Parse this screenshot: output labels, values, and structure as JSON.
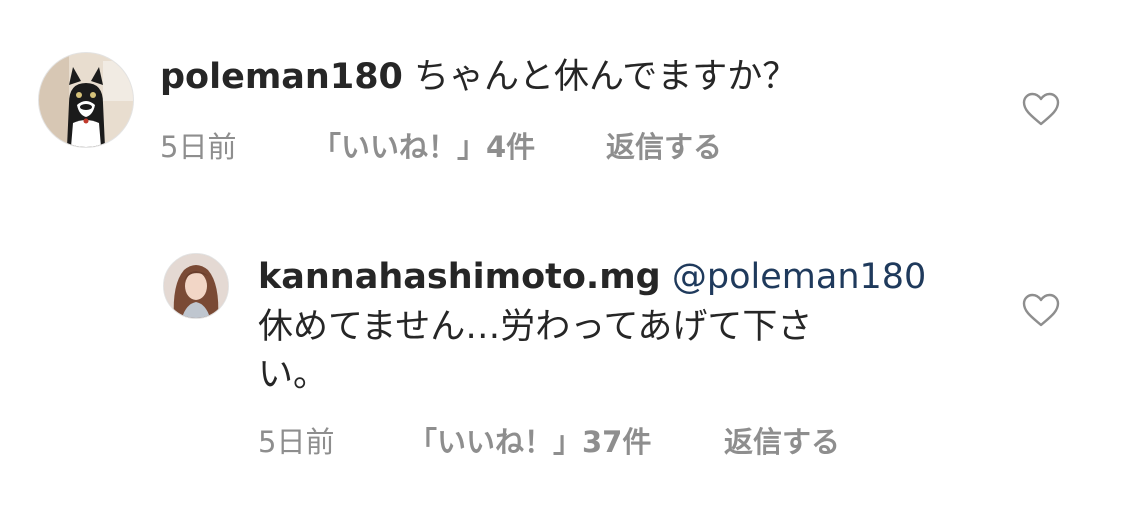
{
  "comments": [
    {
      "username": "poleman180",
      "text": "ちゃんと休んでますか？",
      "time": "5日前",
      "likes": "「いいね！」4件",
      "reply": "返信する",
      "avatar": "black-white-cat-avatar",
      "heart_icon": "heart-outline-icon"
    },
    {
      "username": "kannahashimoto.mg",
      "mention": "@poleman180",
      "text_line1": "休めてません…労わってあげて下さ",
      "text_line2": "い。",
      "time": "5日前",
      "likes": "「いいね！」37件",
      "reply": "返信する",
      "avatar": "woman-portrait-avatar",
      "heart_icon": "heart-outline-icon"
    }
  ]
}
